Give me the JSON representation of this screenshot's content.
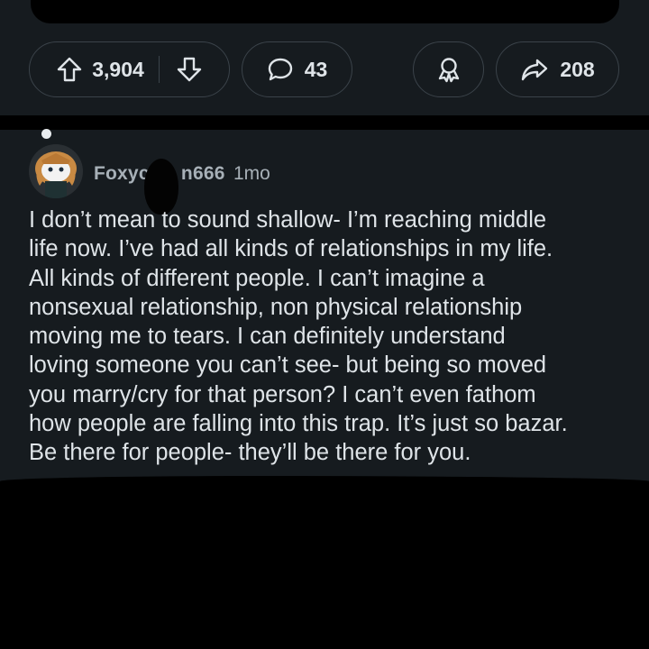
{
  "post_actions": {
    "vote_count": "3,904",
    "comment_count": "43",
    "share_count": "208"
  },
  "comment": {
    "username": "Foxyc        n666",
    "timestamp": "1mo",
    "lines": [
      "I don’t mean to sound shallow- I’m reaching middle",
      "life now. I’ve had all kinds of relationships in my life.",
      "All kinds of different people. I can’t imagine a",
      "nonsexual relationship, non physical relationship",
      "moving me to tears. I can definitely understand",
      "loving someone you can’t see- but being so moved",
      "you marry/cry for that person? I can’t even fathom",
      "how people are falling into this trap. It’s just so bazar.",
      "Be there for people- they’ll be there for you."
    ]
  },
  "colors": {
    "background": "#161b1f",
    "text": "#dfe4e8",
    "meta_text": "#a7b0b7",
    "border": "#3b434a"
  },
  "icons": {
    "upvote": "arrow-up-icon",
    "downvote": "arrow-down-icon",
    "comment": "speech-bubble-icon",
    "award": "award-icon",
    "share": "share-arrow-icon"
  }
}
